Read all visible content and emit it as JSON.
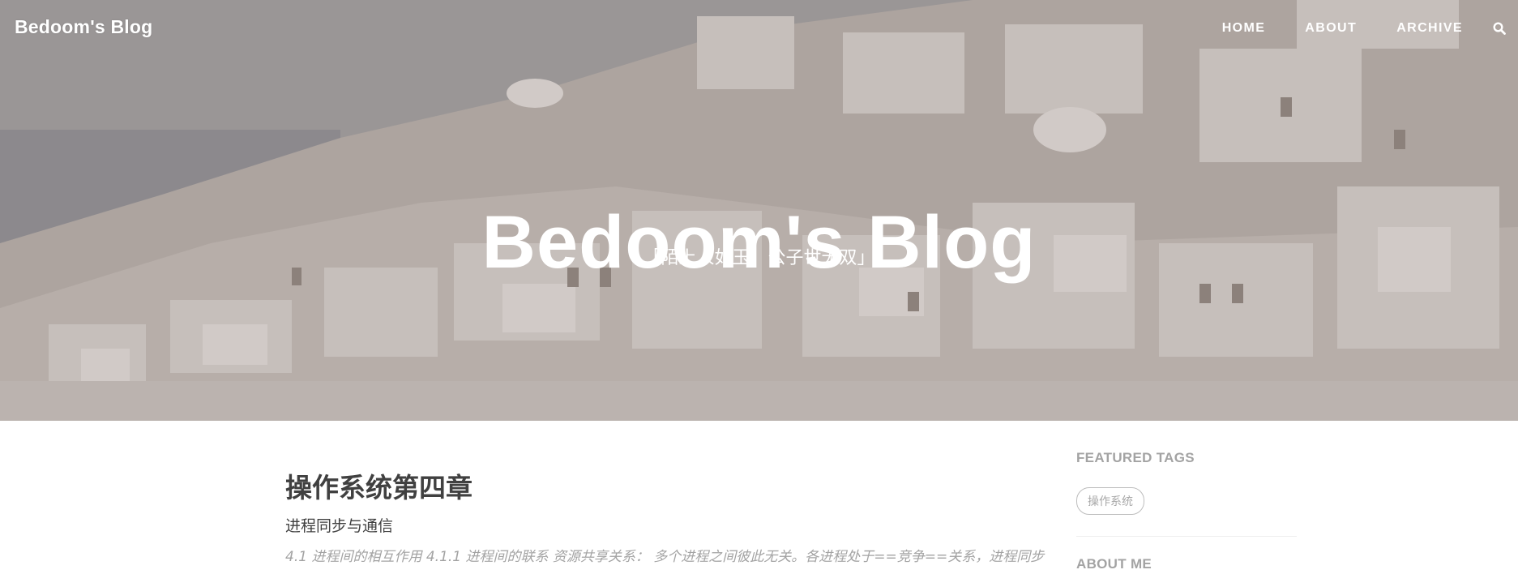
{
  "nav": {
    "brand": "Bedoom's Blog",
    "links": [
      "HOME",
      "ABOUT",
      "ARCHIVE"
    ],
    "search_icon": "search-icon"
  },
  "hero": {
    "title": "Bedoom's Blog",
    "subtitle": "「陌上人如玉，公子世无双」"
  },
  "post": {
    "title": "操作系统第四章",
    "subtitle": "进程同步与通信",
    "excerpt": "4.1 进程间的相互作用 4.1.1 进程间的联系 资源共享关系： 多个进程之间彼此无关。各进程处于==竞争==关系，进程同步"
  },
  "sidebar": {
    "featured_tags_heading": "FEATURED TAGS",
    "tags": [
      "操作系统"
    ],
    "about_heading": "ABOUT ME"
  }
}
